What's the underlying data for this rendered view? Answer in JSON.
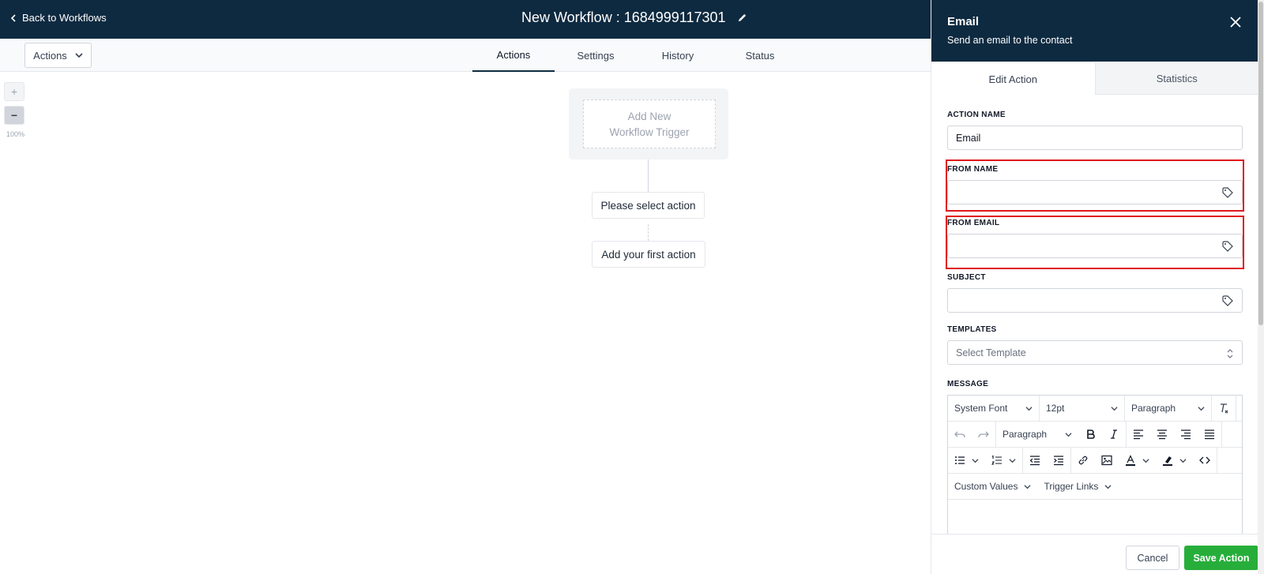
{
  "header": {
    "back_label": "Back to Workflows",
    "workflow_title": "New Workflow : 1684999117301"
  },
  "toolbar": {
    "actions_label": "Actions",
    "tabs": [
      "Actions",
      "Settings",
      "History",
      "Status"
    ],
    "active_tab": "Actions"
  },
  "canvas": {
    "zoom_in": "+",
    "zoom_out": "−",
    "zoom_level": "100%",
    "trigger_line1": "Add New",
    "trigger_line2": "Workflow Trigger",
    "select_action": "Please select action",
    "first_action": "Add your first action"
  },
  "panel": {
    "title": "Email",
    "subtitle": "Send an email to the contact",
    "tabs": [
      "Edit Action",
      "Statistics"
    ],
    "active_tab": "Edit Action",
    "fields": {
      "action_name": {
        "label": "ACTION NAME",
        "value": "Email"
      },
      "from_name": {
        "label": "FROM NAME",
        "value": ""
      },
      "from_email": {
        "label": "FROM EMAIL",
        "value": ""
      },
      "subject": {
        "label": "SUBJECT",
        "value": ""
      },
      "templates": {
        "label": "TEMPLATES",
        "placeholder": "Select Template"
      },
      "message": {
        "label": "MESSAGE"
      }
    },
    "editor": {
      "font": "System Font",
      "size": "12pt",
      "block_format_1": "Paragraph",
      "block_format_2": "Paragraph",
      "custom_values": "Custom Values",
      "trigger_links": "Trigger Links"
    },
    "footer": {
      "cancel": "Cancel",
      "save": "Save Action"
    }
  },
  "colors": {
    "header_bg": "#0e2a40",
    "save_green": "#27ae3a",
    "highlight_red": "#e0161c"
  }
}
